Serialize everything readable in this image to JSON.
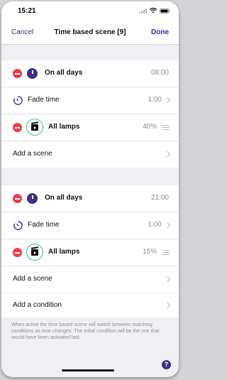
{
  "status_bar": {
    "time": "15:21"
  },
  "nav": {
    "cancel": "Cancel",
    "title": "Time based scene [9]",
    "done": "Done"
  },
  "blocks": [
    {
      "day_label": "On all days",
      "time": "08:00",
      "fade_label": "Fade time",
      "fade_value": "1:00",
      "scene_label": "All lamps",
      "scene_value": "40%",
      "add_scene": "Add a scene"
    },
    {
      "day_label": "On all days",
      "time": "21:00",
      "fade_label": "Fade time",
      "fade_value": "1:00",
      "scene_label": "All lamps",
      "scene_value": "15%",
      "add_scene": "Add a scene"
    }
  ],
  "condition": {
    "label": "Add a condition"
  },
  "footer_note": "When active the time based scene will switch between matching conditions as time changes. The initial condition will be the one that would have been activated last.",
  "help_label": "?",
  "colors": {
    "accent": "#3d2d8c",
    "delete": "#ee3d43",
    "scene_ring": "#45b98b"
  }
}
